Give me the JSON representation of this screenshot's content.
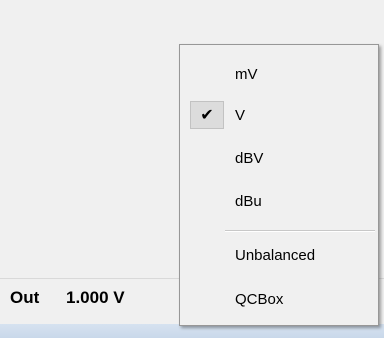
{
  "status": {
    "out_label": "Out",
    "out_value": "1.000 V"
  },
  "menu": {
    "items": [
      {
        "label": "mV",
        "checked": false
      },
      {
        "label": "V",
        "checked": true
      },
      {
        "label": "dBV",
        "checked": false
      },
      {
        "label": "dBu",
        "checked": false
      }
    ],
    "extra_items": [
      {
        "label": "Unbalanced"
      },
      {
        "label": "QCBox"
      }
    ],
    "check_glyph": "✔"
  }
}
